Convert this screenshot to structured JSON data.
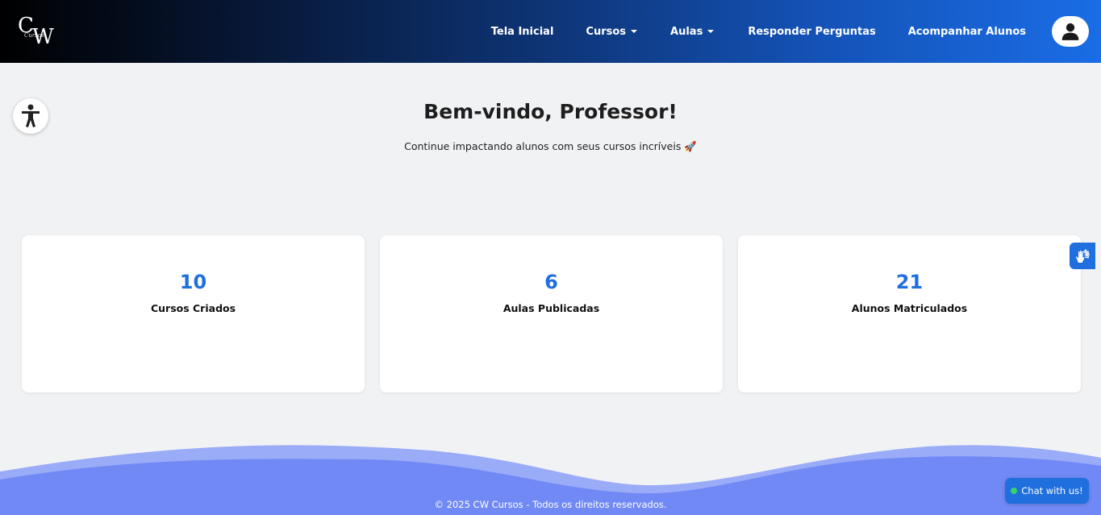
{
  "navbar": {
    "logo_text": "CW",
    "items": [
      {
        "label": "Tela Inicial",
        "dropdown": false
      },
      {
        "label": "Cursos",
        "dropdown": true
      },
      {
        "label": "Aulas",
        "dropdown": true
      },
      {
        "label": "Responder Perguntas",
        "dropdown": false
      },
      {
        "label": "Acompanhar Alunos",
        "dropdown": false
      }
    ],
    "avatar_icon": "user-icon"
  },
  "hero": {
    "title": "Bem-vindo, Professor!",
    "subtitle": "Continue impactando alunos com seus cursos incríveis 🚀"
  },
  "stats": [
    {
      "value": "10",
      "label": "Cursos Criados"
    },
    {
      "value": "6",
      "label": "Aulas Publicadas"
    },
    {
      "value": "21",
      "label": "Alunos Matriculados"
    }
  ],
  "footer": {
    "text": "© 2025 CW Cursos - Todos os direitos reservados."
  },
  "chat": {
    "label": "Chat with us!"
  },
  "colors": {
    "accent": "#1f6fde",
    "wave": "#7089f5",
    "background": "#f1f2f4"
  }
}
